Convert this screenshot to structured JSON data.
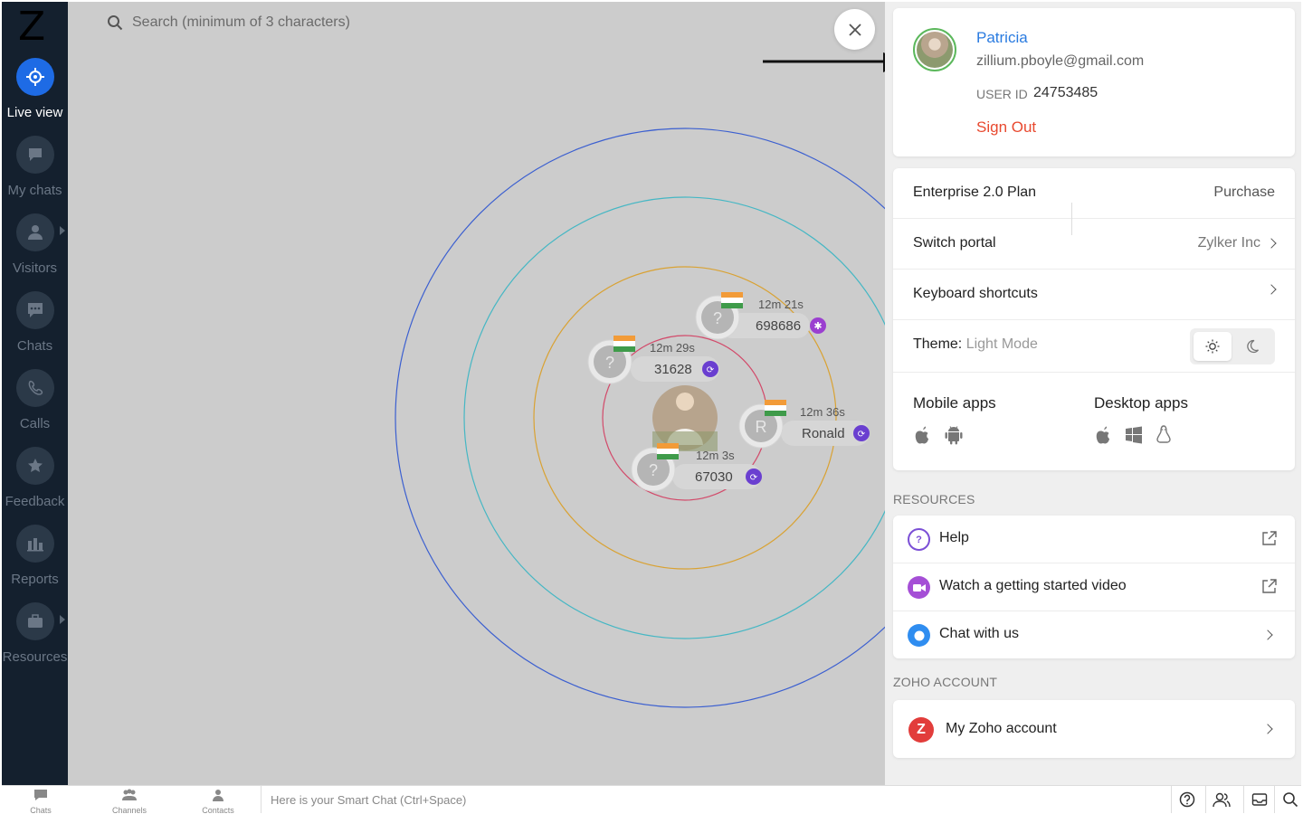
{
  "app": {
    "logo_letter": "Z"
  },
  "sidebar": {
    "items": [
      {
        "label": "Live view",
        "icon": "target-icon",
        "active": true
      },
      {
        "label": "My chats",
        "icon": "chat-bubble-icon",
        "active": false
      },
      {
        "label": "Visitors",
        "icon": "person-icon",
        "active": false,
        "has_submenu": true
      },
      {
        "label": "Chats",
        "icon": "chat-dots-icon",
        "active": false
      },
      {
        "label": "Calls",
        "icon": "phone-icon",
        "active": false
      },
      {
        "label": "Feedback",
        "icon": "star-icon",
        "active": false
      },
      {
        "label": "Reports",
        "icon": "bar-chart-icon",
        "active": false
      },
      {
        "label": "Resources",
        "icon": "briefcase-icon",
        "active": false,
        "has_submenu": true
      }
    ]
  },
  "main": {
    "search_placeholder": "Search (minimum of 3 characters)",
    "visitors": [
      {
        "time": "12m 21s",
        "id": "698686",
        "flag": "india"
      },
      {
        "time": "12m 29s",
        "id": "31628",
        "flag": "india"
      },
      {
        "time": "12m 36s",
        "id": "Ronald",
        "flag": "india"
      },
      {
        "time": "12m 3s",
        "id": "67030",
        "flag": "india"
      }
    ]
  },
  "profile": {
    "name": "Patricia",
    "email": "zillium.pboyle@gmail.com",
    "user_id_label": "USER ID",
    "user_id": "24753485",
    "sign_out": "Sign Out"
  },
  "settings": {
    "plan": "Enterprise 2.0 Plan",
    "purchase": "Purchase",
    "switch_portal": "Switch portal",
    "portal_name": "Zylker Inc",
    "keyboard_shortcuts": "Keyboard shortcuts",
    "theme_label": "Theme:",
    "theme_value": "Light Mode",
    "mobile_apps": "Mobile apps",
    "desktop_apps": "Desktop apps"
  },
  "resources": {
    "heading": "RESOURCES",
    "items": [
      {
        "label": "Help",
        "icon": "help-icon",
        "color": "#7b4fd6"
      },
      {
        "label": "Watch a getting started video",
        "icon": "video-icon",
        "color": "#a54fd6"
      },
      {
        "label": "Chat with us",
        "icon": "chat-icon",
        "color": "#2f8df0"
      }
    ]
  },
  "zoho_account": {
    "heading": "ZOHO ACCOUNT",
    "label": "My Zoho account",
    "badge": "Z"
  },
  "bottombar": {
    "items": [
      {
        "label": "Chats"
      },
      {
        "label": "Channels"
      },
      {
        "label": "Contacts"
      }
    ],
    "smart_chat": "Here is your Smart Chat (Ctrl+Space)"
  },
  "colors": {
    "accent": "#1e6be5",
    "sign_out": "#e8492f",
    "name_link": "#2a7be0",
    "orbit_blue": "#3b5fd0",
    "orbit_cyan": "#45b7c4",
    "orbit_orange": "#d9a233",
    "orbit_red": "#d24a6a"
  }
}
